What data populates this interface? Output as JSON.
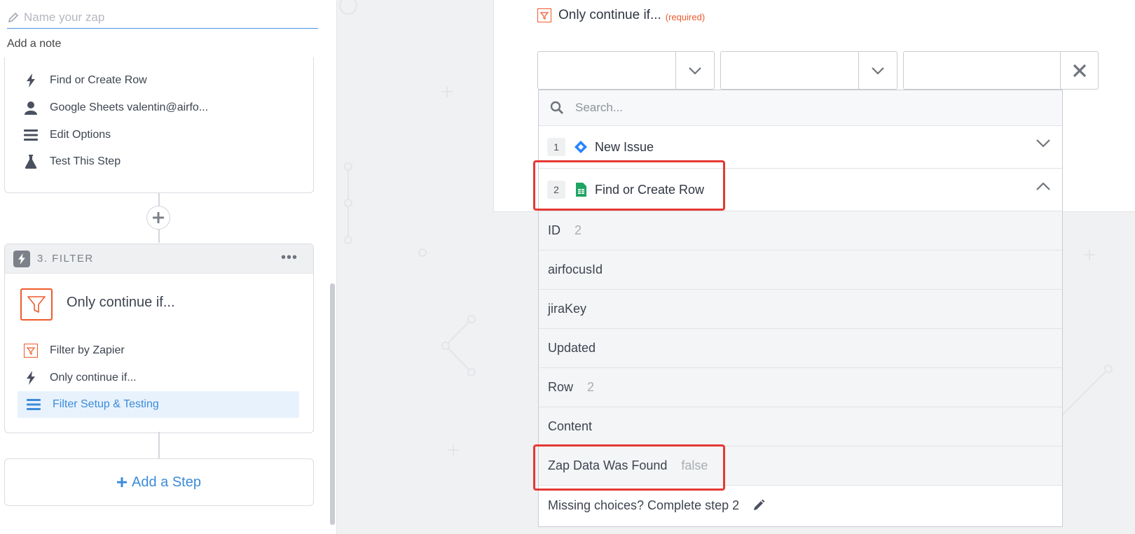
{
  "editor": {
    "zap_name_placeholder": "Name your zap",
    "add_note": "Add a note"
  },
  "step2_menu": [
    {
      "icon": "bolt-icon",
      "label": "Find or Create Row"
    },
    {
      "icon": "user-icon",
      "label": "Google Sheets valentin@airfo..."
    },
    {
      "icon": "list-icon",
      "label": "Edit Options"
    },
    {
      "icon": "flask-icon",
      "label": "Test This Step"
    }
  ],
  "step3": {
    "header": "3. FILTER",
    "more": "•••",
    "title": "Only continue if...",
    "menu": [
      {
        "icon": "filter-icon",
        "label": "Filter by Zapier"
      },
      {
        "icon": "bolt-icon",
        "label": "Only continue if..."
      },
      {
        "icon": "list-icon",
        "label": "Filter Setup & Testing"
      }
    ]
  },
  "add_step": "Add a Step",
  "filter_panel": {
    "title": "Only continue if...",
    "required": "(required)"
  },
  "dropdown": {
    "search_placeholder": "Search...",
    "steps": [
      {
        "num": "1",
        "label": "New Issue",
        "app_icon": "jira-diamond-icon",
        "expanded": false
      },
      {
        "num": "2",
        "label": "Find or Create Row",
        "app_icon": "google-sheets-icon",
        "expanded": true
      }
    ],
    "options": [
      {
        "key": "ID",
        "value": "2"
      },
      {
        "key": "airfocusId",
        "value": ""
      },
      {
        "key": "jiraKey",
        "value": ""
      },
      {
        "key": "Updated",
        "value": ""
      },
      {
        "key": "Row",
        "value": "2"
      },
      {
        "key": "Content",
        "value": ""
      },
      {
        "key": "Zap Data Was Found",
        "value": "false"
      }
    ],
    "missing": "Missing choices? Complete step 2"
  },
  "colors": {
    "accent_blue": "#3c8bd9",
    "filter_orange": "#ef5a2b",
    "highlight_red": "#e53935",
    "sheets_green": "#1fa463",
    "jira_blue": "#2684ff"
  }
}
